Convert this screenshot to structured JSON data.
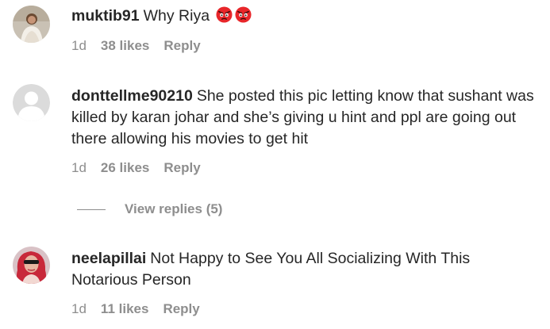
{
  "comments": [
    {
      "username": "muktib91",
      "text": "Why Riya",
      "emojis": [
        "angry-face-icon",
        "angry-face-icon"
      ],
      "time": "1d",
      "likes": "38 likes",
      "reply": "Reply"
    },
    {
      "username": "donttellme90210",
      "text": "She posted this pic letting know that sushant was killed by karan johar and she’s giving u hint and ppl are going out there allowing his movies to get hit",
      "time": "1d",
      "likes": "26 likes",
      "reply": "Reply",
      "view_replies": "View replies (5)"
    },
    {
      "username": "neelapillai",
      "text": "Not Happy to See You All Socializing With This Notarious Person",
      "time": "1d",
      "likes": "11 likes",
      "reply": "Reply"
    }
  ],
  "colors": {
    "text": "#262626",
    "secondary": "#8e8e8e",
    "emoji_red": "#e8262a"
  }
}
